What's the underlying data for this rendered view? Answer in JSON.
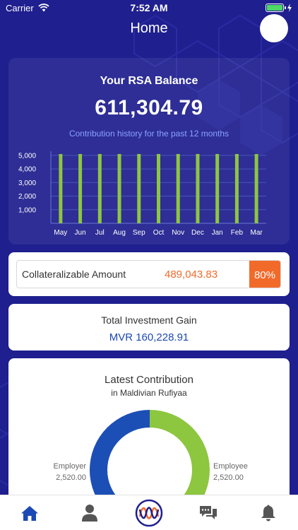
{
  "status_bar": {
    "carrier": "Carrier",
    "time": "7:52 AM"
  },
  "header": {
    "title": "Home"
  },
  "balance": {
    "title": "Your RSA Balance",
    "value": "611,304.79",
    "subtitle": "Contribution history for the past 12 months"
  },
  "chart_data": {
    "type": "bar",
    "categories": [
      "May",
      "Jun",
      "Jul",
      "Aug",
      "Sep",
      "Oct",
      "Nov",
      "Dec",
      "Jan",
      "Feb",
      "Mar"
    ],
    "values": [
      5100,
      5100,
      5100,
      5100,
      5100,
      5100,
      5100,
      5100,
      5100,
      5100,
      5100
    ],
    "yticks": [
      1000,
      2000,
      3000,
      4000,
      5000
    ],
    "ytick_labels": [
      "1,000",
      "2,000",
      "3,000",
      "4,000",
      "5,000"
    ],
    "ylim": [
      0,
      5200
    ],
    "grid": true,
    "bar_color": "#8dc63f"
  },
  "collateral": {
    "label": "Collateralizable Amount",
    "value": "489,043.83",
    "percent": "80%"
  },
  "investment": {
    "label": "Total Investment Gain",
    "value": "MVR 160,228.91"
  },
  "latest": {
    "title": "Latest Contribution",
    "subtitle": "in Maldivian Rufiyaa",
    "employer_label": "Employer",
    "employer_value": "2,520.00",
    "employee_label": "Employee",
    "employee_value": "2,520.00",
    "employer_amount": 2520,
    "employee_amount": 2520,
    "employer_color": "#1c4fb5",
    "employee_color": "#8dc63f"
  },
  "tabs": [
    {
      "icon": "home-icon",
      "active": true
    },
    {
      "icon": "profile-icon",
      "active": false
    },
    {
      "icon": "logo-icon",
      "active": false
    },
    {
      "icon": "chat-icon",
      "active": false
    },
    {
      "icon": "bell-icon",
      "active": false
    }
  ],
  "colors": {
    "background": "#1f1f8f",
    "accent_orange": "#f26a2a",
    "accent_blue": "#1c49b5",
    "accent_green": "#8dc63f"
  }
}
